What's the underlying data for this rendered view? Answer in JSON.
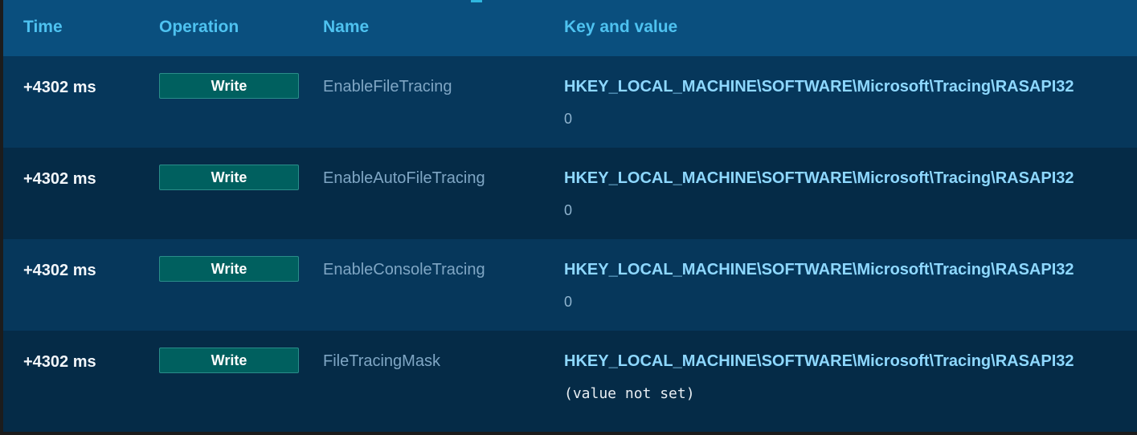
{
  "table": {
    "headers": {
      "time": "Time",
      "operation": "Operation",
      "name": "Name",
      "key_and_value": "Key and value"
    },
    "rows": [
      {
        "time": "+4302 ms",
        "operation": "Write",
        "name": "EnableFileTracing",
        "key": "HKEY_LOCAL_MACHINE\\SOFTWARE\\Microsoft\\Tracing\\RASAPI32",
        "value": "0"
      },
      {
        "time": "+4302 ms",
        "operation": "Write",
        "name": "EnableAutoFileTracing",
        "key": "HKEY_LOCAL_MACHINE\\SOFTWARE\\Microsoft\\Tracing\\RASAPI32",
        "value": "0"
      },
      {
        "time": "+4302 ms",
        "operation": "Write",
        "name": "EnableConsoleTracing",
        "key": "HKEY_LOCAL_MACHINE\\SOFTWARE\\Microsoft\\Tracing\\RASAPI32",
        "value": "0"
      },
      {
        "time": "+4302 ms",
        "operation": "Write",
        "name": "FileTracingMask",
        "key": "HKEY_LOCAL_MACHINE\\SOFTWARE\\Microsoft\\Tracing\\RASAPI32",
        "value": "(value not set)"
      }
    ]
  },
  "colors": {
    "background": "#052b47",
    "row_alt": "#06375b",
    "header": "#0a4f7e",
    "header_text": "#4ec2f0",
    "operation_badge": "#00605f",
    "key_text": "#8ed8ff"
  }
}
